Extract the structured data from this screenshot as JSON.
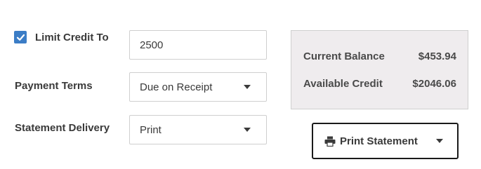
{
  "credit": {
    "limit_checkbox_checked": true,
    "limit_label": "Limit Credit To",
    "limit_value": "2500"
  },
  "payment_terms": {
    "label": "Payment Terms",
    "selected": "Due on Receipt"
  },
  "statement_delivery": {
    "label": "Statement Delivery",
    "selected": "Print"
  },
  "balance": {
    "current_label": "Current Balance",
    "current_value": "$453.94",
    "available_label": "Available Credit",
    "available_value": "$2046.06"
  },
  "print_statement": {
    "label": "Print Statement",
    "icon": "printer-icon"
  },
  "colors": {
    "checkbox": "#3b7dc6",
    "panel_bg": "#efecee",
    "button_border": "#1a1a1a"
  }
}
